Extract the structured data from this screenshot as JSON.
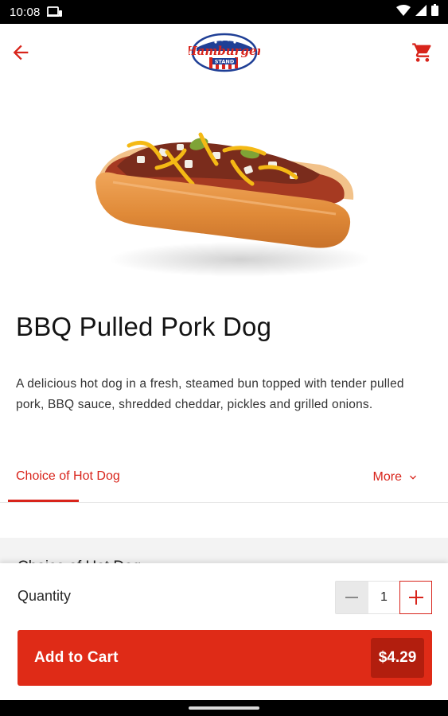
{
  "status_bar": {
    "time": "10:08",
    "icons": [
      "notification-icon",
      "wifi-icon",
      "signal-icon",
      "battery-icon"
    ]
  },
  "header": {
    "back_icon": "arrow-left-icon",
    "cart_icon": "shopping-cart-icon",
    "logo_alt": "Hamburger Stand logo"
  },
  "product": {
    "image": "hot-dog-image",
    "name": "BBQ Pulled Pork Dog",
    "description": "A delicious hot dog in a fresh, steamed bun topped with tender pulled pork, BBQ sauce, shredded cheddar, pickles and grilled onions."
  },
  "tabs": {
    "active": "Choice of Hot Dog",
    "more_label": "More"
  },
  "section": {
    "heading": "Choice of Hot Dog"
  },
  "cart_panel": {
    "quantity_label": "Quantity",
    "quantity_value": "1",
    "add_to_cart_label": "Add to Cart",
    "price": "$4.29"
  },
  "colors": {
    "accent": "#df2b17",
    "accent_dark": "#b21e0e",
    "tab_red": "#d8241b"
  }
}
